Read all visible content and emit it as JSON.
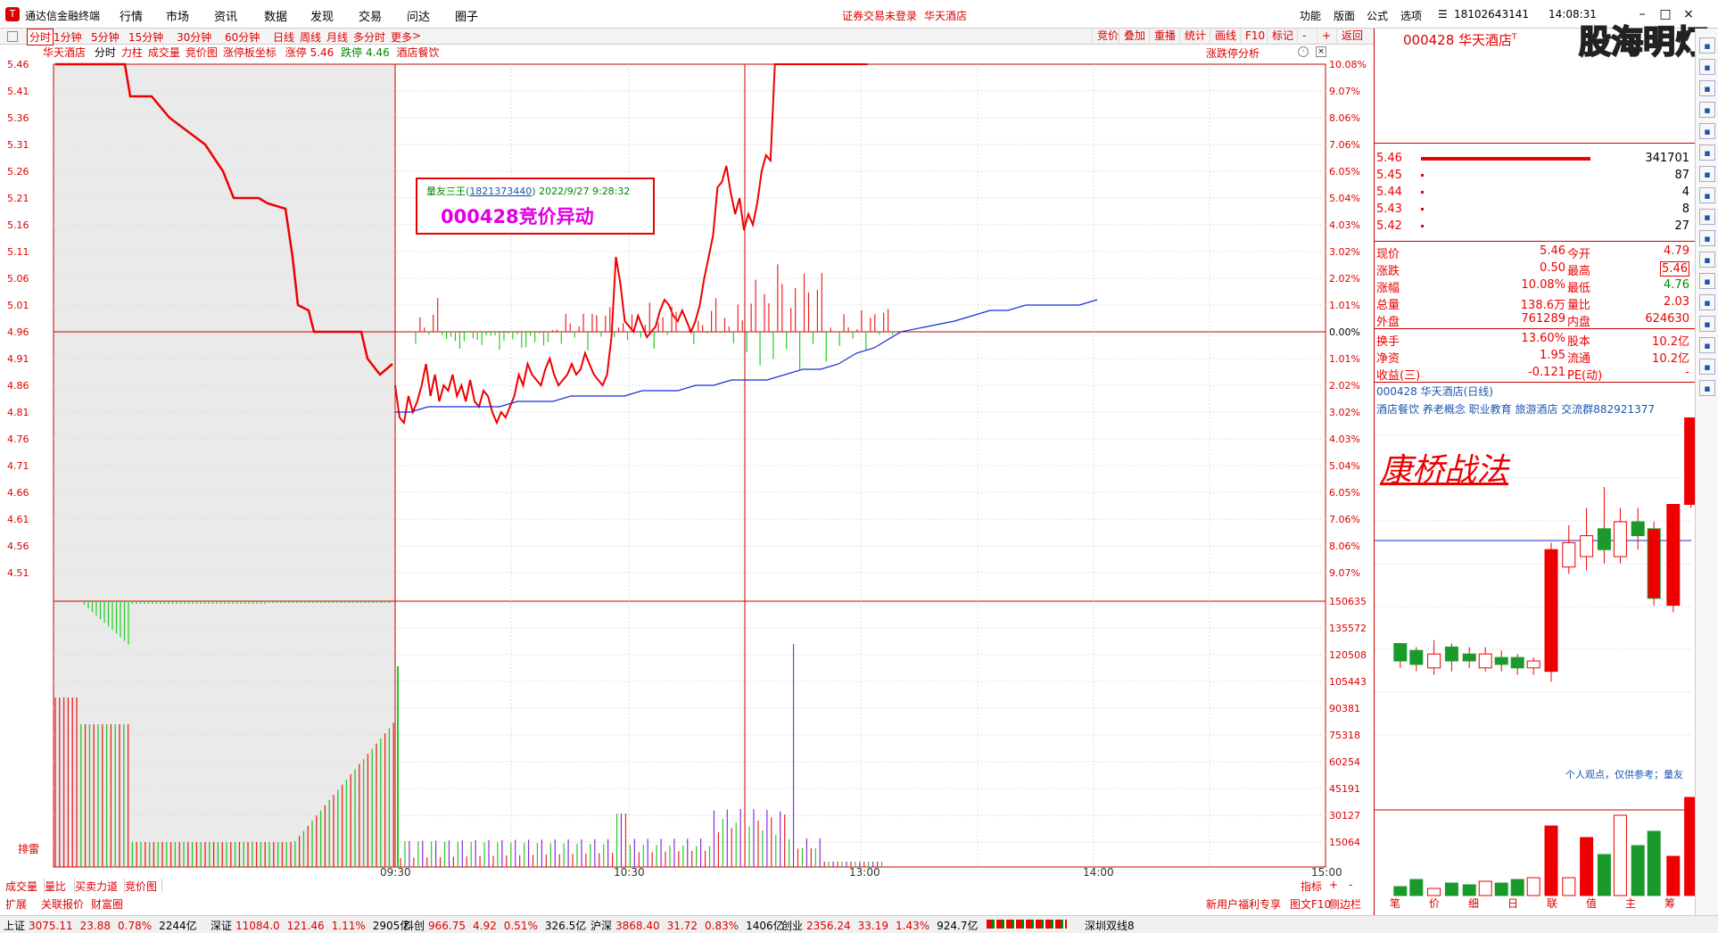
{
  "app": {
    "name": "通达信金融终端"
  },
  "menu": [
    "行情",
    "市场",
    "资讯",
    "数据",
    "发现",
    "交易",
    "问达",
    "圈子"
  ],
  "center_notice": "证券交易未登录",
  "center_stock": "华天酒店",
  "right_menu": [
    "功能",
    "版面",
    "公式",
    "选项"
  ],
  "user_phone": "18102643141",
  "clock": "14:08:31",
  "watermark": "股海明灯",
  "toolbar": {
    "periods": [
      "分时",
      "1分钟",
      "5分钟",
      "15分钟",
      "30分钟",
      "60分钟",
      "日线",
      "周线",
      "月线",
      "多分时",
      "更多"
    ],
    "buttons": [
      "竞价",
      "叠加",
      "重播",
      "统计",
      "画线",
      "F10",
      "标记",
      "-",
      "+",
      "返回"
    ]
  },
  "info": {
    "name": "华天酒店",
    "items": [
      "分时",
      "力柱",
      "成交量",
      "竞价图",
      "涨停板坐标"
    ],
    "limit_up_label": "涨停",
    "limit_up": "5.46",
    "limit_down_label": "跌停",
    "limit_down": "4.46",
    "sector": "酒店餐饮",
    "analysis": "涨跌停分析"
  },
  "price_axis": [
    "5.46",
    "5.41",
    "5.36",
    "5.31",
    "5.26",
    "5.21",
    "5.16",
    "5.11",
    "5.06",
    "5.01",
    "4.96",
    "4.91",
    "4.86",
    "4.81",
    "4.76",
    "4.71",
    "4.66",
    "4.61",
    "4.56",
    "4.51"
  ],
  "pct_axis": [
    "10.08%",
    "9.07%",
    "8.06%",
    "7.06%",
    "6.05%",
    "5.04%",
    "4.03%",
    "3.02%",
    "2.02%",
    "1.01%",
    "0.00%",
    "1.01%",
    "2.02%",
    "3.02%",
    "4.03%",
    "5.04%",
    "6.05%",
    "7.06%",
    "8.06%",
    "9.07%"
  ],
  "vol_axis": [
    "150635",
    "135572",
    "120508",
    "105443",
    "90381",
    "75318",
    "60254",
    "45191",
    "30127",
    "15064"
  ],
  "vol_label": "排雷",
  "time_axis": [
    "09:30",
    "10:30",
    "13:00",
    "14:00",
    "15:00"
  ],
  "annotation": {
    "author": "量友三王",
    "phone": "1821373440",
    "datetime": "2022/9/27 9:28:32",
    "title": "000428竞价异动"
  },
  "bottom_tabs": [
    "成交量",
    "量比",
    "买卖力道",
    "竞价图"
  ],
  "bottom_tabs2": [
    "扩展",
    "关联报价",
    "财富圈"
  ],
  "bottom_right": [
    "指标",
    "+",
    "-"
  ],
  "bottom_right2": [
    "新用户福利专享",
    "图文F10",
    "侧边栏"
  ],
  "rp": {
    "header": "000428 华天酒店",
    "header_sup": "T",
    "order_book": [
      {
        "price": "5.46",
        "vol": "341701"
      },
      {
        "price": "5.45",
        "vol": "87"
      },
      {
        "price": "5.44",
        "vol": "4"
      },
      {
        "price": "5.43",
        "vol": "8"
      },
      {
        "price": "5.42",
        "vol": "27"
      }
    ],
    "quote": [
      {
        "l": "现价",
        "v1": "5.46",
        "l2": "今开",
        "v2": "4.79"
      },
      {
        "l": "涨跌",
        "v1": "0.50",
        "l2": "最高",
        "v2": "5.46"
      },
      {
        "l": "涨幅",
        "v1": "10.08%",
        "l2": "最低",
        "v2": "4.76"
      },
      {
        "l": "总量",
        "v1": "138.6万",
        "l2": "量比",
        "v2": "2.03"
      },
      {
        "l": "外盘",
        "v1": "761289",
        "l2": "内盘",
        "v2": "624630"
      }
    ],
    "quote2": [
      {
        "l": "换手",
        "v1": "13.60%",
        "l2": "股本",
        "v2": "10.2亿"
      },
      {
        "l": "净资",
        "v1": "1.95",
        "l2": "流通",
        "v2": "10.2亿"
      },
      {
        "l": "收益(三)",
        "v1": "-0.121",
        "l2": "PE(动)",
        "v2": "-"
      }
    ],
    "kline_title": "000428 华天酒店(日线)",
    "kline_tags": "酒店餐饮 养老概念 职业教育 旅游酒店 交流群882921377",
    "kline_overlay": "康桥战法",
    "kline_note": "个人观点，仅供参考；量友",
    "bottom_tabs": [
      "笔",
      "价",
      "细",
      "日",
      "联",
      "值",
      "主",
      "筹"
    ]
  },
  "status": [
    {
      "n": "上证",
      "v": "3075.11",
      "c": "23.88",
      "p": "0.78%",
      "a": "2244亿"
    },
    {
      "n": "深证",
      "v": "11084.0",
      "c": "121.46",
      "p": "1.11%",
      "a": "2905亿"
    },
    {
      "n": "科创",
      "v": "966.75",
      "c": "4.92",
      "p": "0.51%",
      "a": "326.5亿"
    },
    {
      "n": "沪深",
      "v": "3868.40",
      "c": "31.72",
      "p": "0.83%",
      "a": "1406亿"
    },
    {
      "n": "创业",
      "v": "2356.24",
      "c": "33.19",
      "p": "1.43%",
      "a": "924.7亿"
    }
  ],
  "status_right": "深圳双线8"
}
